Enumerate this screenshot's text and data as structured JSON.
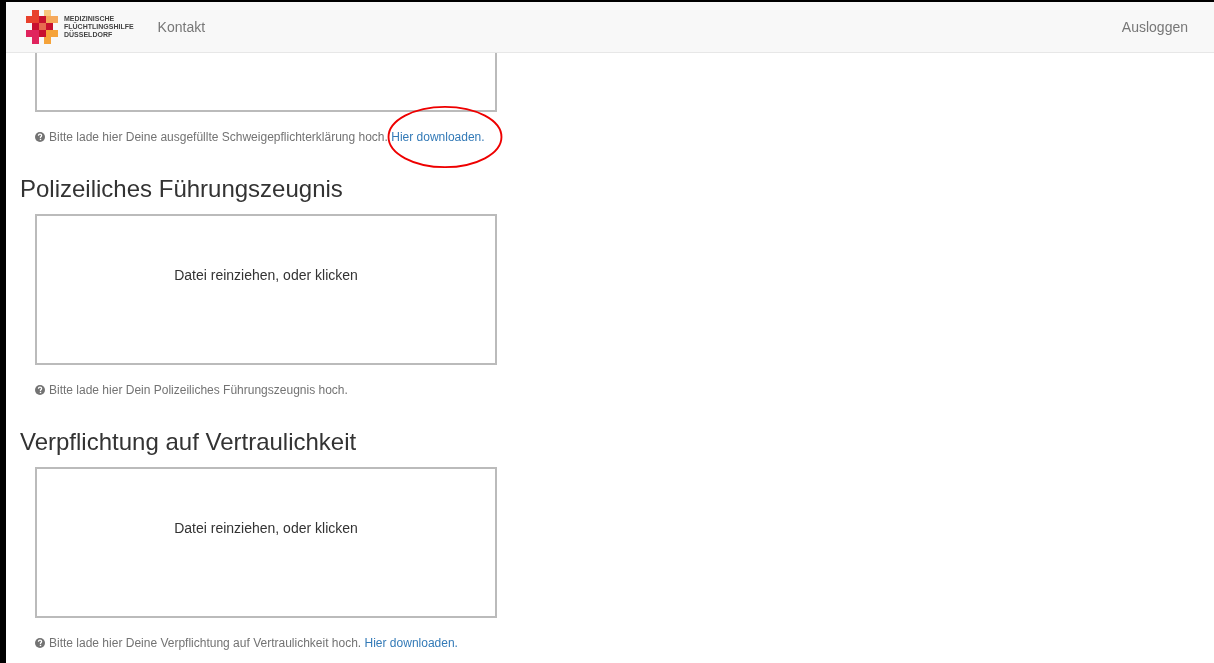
{
  "navbar": {
    "logo_lines": [
      "MEDIZINISCHE",
      "FLÜCHTLINGSHILFE",
      "DÜSSELDORF"
    ],
    "links": [
      "Kontakt"
    ],
    "logout": "Ausloggen"
  },
  "sections": [
    {
      "help": "Bitte lade hier Deine ausgefüllte Schweigepflichterklärung hoch.",
      "link": "Hier downloaden.",
      "circled": true
    },
    {
      "heading": "Polizeiliches Führungszeugnis",
      "dropzone": "Datei reinziehen, oder klicken",
      "help": "Bitte lade hier Dein Polizeiliches Führungszeugnis hoch."
    },
    {
      "heading": "Verpflichtung auf Vertraulichkeit",
      "dropzone": "Datei reinziehen, oder klicken",
      "help": "Bitte lade hier Deine Verpflichtung auf Vertraulichkeit hoch.",
      "link": "Hier downloaden."
    }
  ]
}
